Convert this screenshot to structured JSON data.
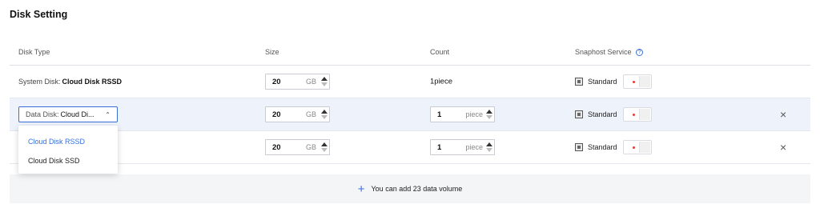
{
  "section_title": "Disk Setting",
  "columns": {
    "disk_type": "Disk Type",
    "size": "Size",
    "count": "Count",
    "snapshot": "Snaphost Service"
  },
  "rows": [
    {
      "type_prefix": "System Disk:",
      "type_value": "Cloud Disk RSSD",
      "size": "20",
      "size_unit": "GB",
      "count_text": "1piece",
      "snapshot_label": "Standard"
    },
    {
      "type_prefix": "Data Disk:",
      "type_value": "Cloud Di...",
      "size": "20",
      "size_unit": "GB",
      "count": "1",
      "count_unit": "piece",
      "snapshot_label": "Standard"
    },
    {
      "size": "20",
      "size_unit": "GB",
      "count": "1",
      "count_unit": "piece",
      "snapshot_label": "Standard"
    }
  ],
  "dropdown": {
    "options": [
      "Cloud Disk RSSD",
      "Cloud Disk SSD"
    ],
    "selected": "Cloud Disk RSSD"
  },
  "add_volume_text": "You can add 23 data volume",
  "icons": {
    "help": "question-circle-icon",
    "snapshot": "snapshot-icon",
    "close": "close-icon",
    "plus": "plus-icon",
    "chevron": "chevron-up-icon"
  },
  "colors": {
    "accent": "#3a6fd8",
    "selected_row_bg": "#eef3fb",
    "toggle_dot": "#e53935"
  }
}
